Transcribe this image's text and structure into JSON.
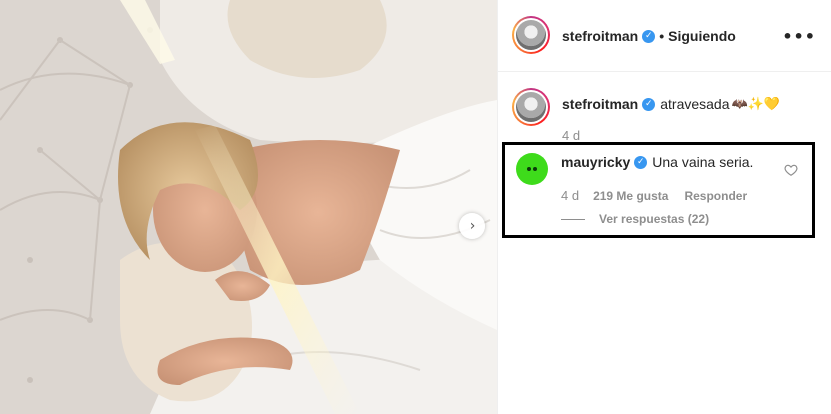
{
  "post": {
    "author": "stefroitman",
    "follow_state": "Siguiendo",
    "separator": "•",
    "verified_icon": "verified-badge-icon",
    "more_label": "•••",
    "next_label": "›"
  },
  "caption": {
    "username": "stefroitman",
    "text": "atravesada",
    "emoji": "🦇✨💛",
    "time": "4 d"
  },
  "comment": {
    "username": "mauyricky",
    "text": "Una vaina seria.",
    "time": "4 d",
    "likes": "219 Me gusta",
    "reply_label": "Responder",
    "view_replies": "Ver respuestas (22)",
    "avatar_color": "#3edb1b",
    "highlight_color": "#000000"
  },
  "colors": {
    "verified": "#3897f0",
    "muted_text": "#8e8e8e",
    "primary_text": "#262626"
  }
}
